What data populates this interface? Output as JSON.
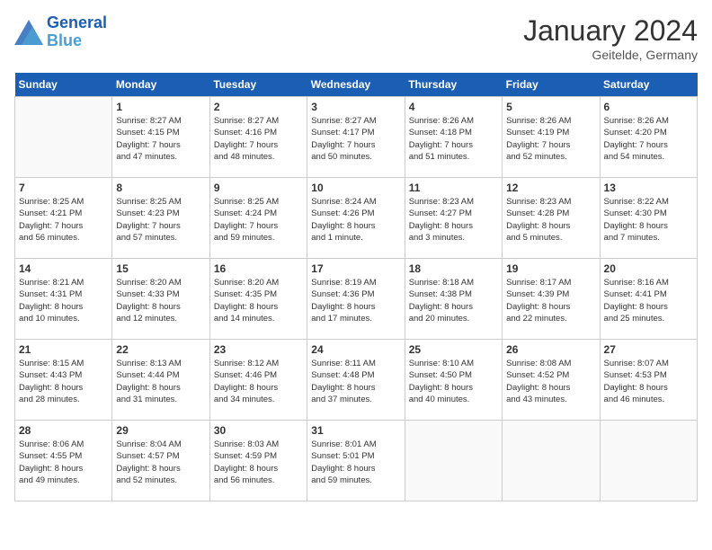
{
  "header": {
    "logo_line1": "General",
    "logo_line2": "Blue",
    "title": "January 2024",
    "location": "Geitelde, Germany"
  },
  "days_of_week": [
    "Sunday",
    "Monday",
    "Tuesday",
    "Wednesday",
    "Thursday",
    "Friday",
    "Saturday"
  ],
  "weeks": [
    [
      {
        "day": "",
        "info": ""
      },
      {
        "day": "1",
        "info": "Sunrise: 8:27 AM\nSunset: 4:15 PM\nDaylight: 7 hours\nand 47 minutes."
      },
      {
        "day": "2",
        "info": "Sunrise: 8:27 AM\nSunset: 4:16 PM\nDaylight: 7 hours\nand 48 minutes."
      },
      {
        "day": "3",
        "info": "Sunrise: 8:27 AM\nSunset: 4:17 PM\nDaylight: 7 hours\nand 50 minutes."
      },
      {
        "day": "4",
        "info": "Sunrise: 8:26 AM\nSunset: 4:18 PM\nDaylight: 7 hours\nand 51 minutes."
      },
      {
        "day": "5",
        "info": "Sunrise: 8:26 AM\nSunset: 4:19 PM\nDaylight: 7 hours\nand 52 minutes."
      },
      {
        "day": "6",
        "info": "Sunrise: 8:26 AM\nSunset: 4:20 PM\nDaylight: 7 hours\nand 54 minutes."
      }
    ],
    [
      {
        "day": "7",
        "info": "Sunrise: 8:25 AM\nSunset: 4:21 PM\nDaylight: 7 hours\nand 56 minutes."
      },
      {
        "day": "8",
        "info": "Sunrise: 8:25 AM\nSunset: 4:23 PM\nDaylight: 7 hours\nand 57 minutes."
      },
      {
        "day": "9",
        "info": "Sunrise: 8:25 AM\nSunset: 4:24 PM\nDaylight: 7 hours\nand 59 minutes."
      },
      {
        "day": "10",
        "info": "Sunrise: 8:24 AM\nSunset: 4:26 PM\nDaylight: 8 hours\nand 1 minute."
      },
      {
        "day": "11",
        "info": "Sunrise: 8:23 AM\nSunset: 4:27 PM\nDaylight: 8 hours\nand 3 minutes."
      },
      {
        "day": "12",
        "info": "Sunrise: 8:23 AM\nSunset: 4:28 PM\nDaylight: 8 hours\nand 5 minutes."
      },
      {
        "day": "13",
        "info": "Sunrise: 8:22 AM\nSunset: 4:30 PM\nDaylight: 8 hours\nand 7 minutes."
      }
    ],
    [
      {
        "day": "14",
        "info": "Sunrise: 8:21 AM\nSunset: 4:31 PM\nDaylight: 8 hours\nand 10 minutes."
      },
      {
        "day": "15",
        "info": "Sunrise: 8:20 AM\nSunset: 4:33 PM\nDaylight: 8 hours\nand 12 minutes."
      },
      {
        "day": "16",
        "info": "Sunrise: 8:20 AM\nSunset: 4:35 PM\nDaylight: 8 hours\nand 14 minutes."
      },
      {
        "day": "17",
        "info": "Sunrise: 8:19 AM\nSunset: 4:36 PM\nDaylight: 8 hours\nand 17 minutes."
      },
      {
        "day": "18",
        "info": "Sunrise: 8:18 AM\nSunset: 4:38 PM\nDaylight: 8 hours\nand 20 minutes."
      },
      {
        "day": "19",
        "info": "Sunrise: 8:17 AM\nSunset: 4:39 PM\nDaylight: 8 hours\nand 22 minutes."
      },
      {
        "day": "20",
        "info": "Sunrise: 8:16 AM\nSunset: 4:41 PM\nDaylight: 8 hours\nand 25 minutes."
      }
    ],
    [
      {
        "day": "21",
        "info": "Sunrise: 8:15 AM\nSunset: 4:43 PM\nDaylight: 8 hours\nand 28 minutes."
      },
      {
        "day": "22",
        "info": "Sunrise: 8:13 AM\nSunset: 4:44 PM\nDaylight: 8 hours\nand 31 minutes."
      },
      {
        "day": "23",
        "info": "Sunrise: 8:12 AM\nSunset: 4:46 PM\nDaylight: 8 hours\nand 34 minutes."
      },
      {
        "day": "24",
        "info": "Sunrise: 8:11 AM\nSunset: 4:48 PM\nDaylight: 8 hours\nand 37 minutes."
      },
      {
        "day": "25",
        "info": "Sunrise: 8:10 AM\nSunset: 4:50 PM\nDaylight: 8 hours\nand 40 minutes."
      },
      {
        "day": "26",
        "info": "Sunrise: 8:08 AM\nSunset: 4:52 PM\nDaylight: 8 hours\nand 43 minutes."
      },
      {
        "day": "27",
        "info": "Sunrise: 8:07 AM\nSunset: 4:53 PM\nDaylight: 8 hours\nand 46 minutes."
      }
    ],
    [
      {
        "day": "28",
        "info": "Sunrise: 8:06 AM\nSunset: 4:55 PM\nDaylight: 8 hours\nand 49 minutes."
      },
      {
        "day": "29",
        "info": "Sunrise: 8:04 AM\nSunset: 4:57 PM\nDaylight: 8 hours\nand 52 minutes."
      },
      {
        "day": "30",
        "info": "Sunrise: 8:03 AM\nSunset: 4:59 PM\nDaylight: 8 hours\nand 56 minutes."
      },
      {
        "day": "31",
        "info": "Sunrise: 8:01 AM\nSunset: 5:01 PM\nDaylight: 8 hours\nand 59 minutes."
      },
      {
        "day": "",
        "info": ""
      },
      {
        "day": "",
        "info": ""
      },
      {
        "day": "",
        "info": ""
      }
    ]
  ]
}
